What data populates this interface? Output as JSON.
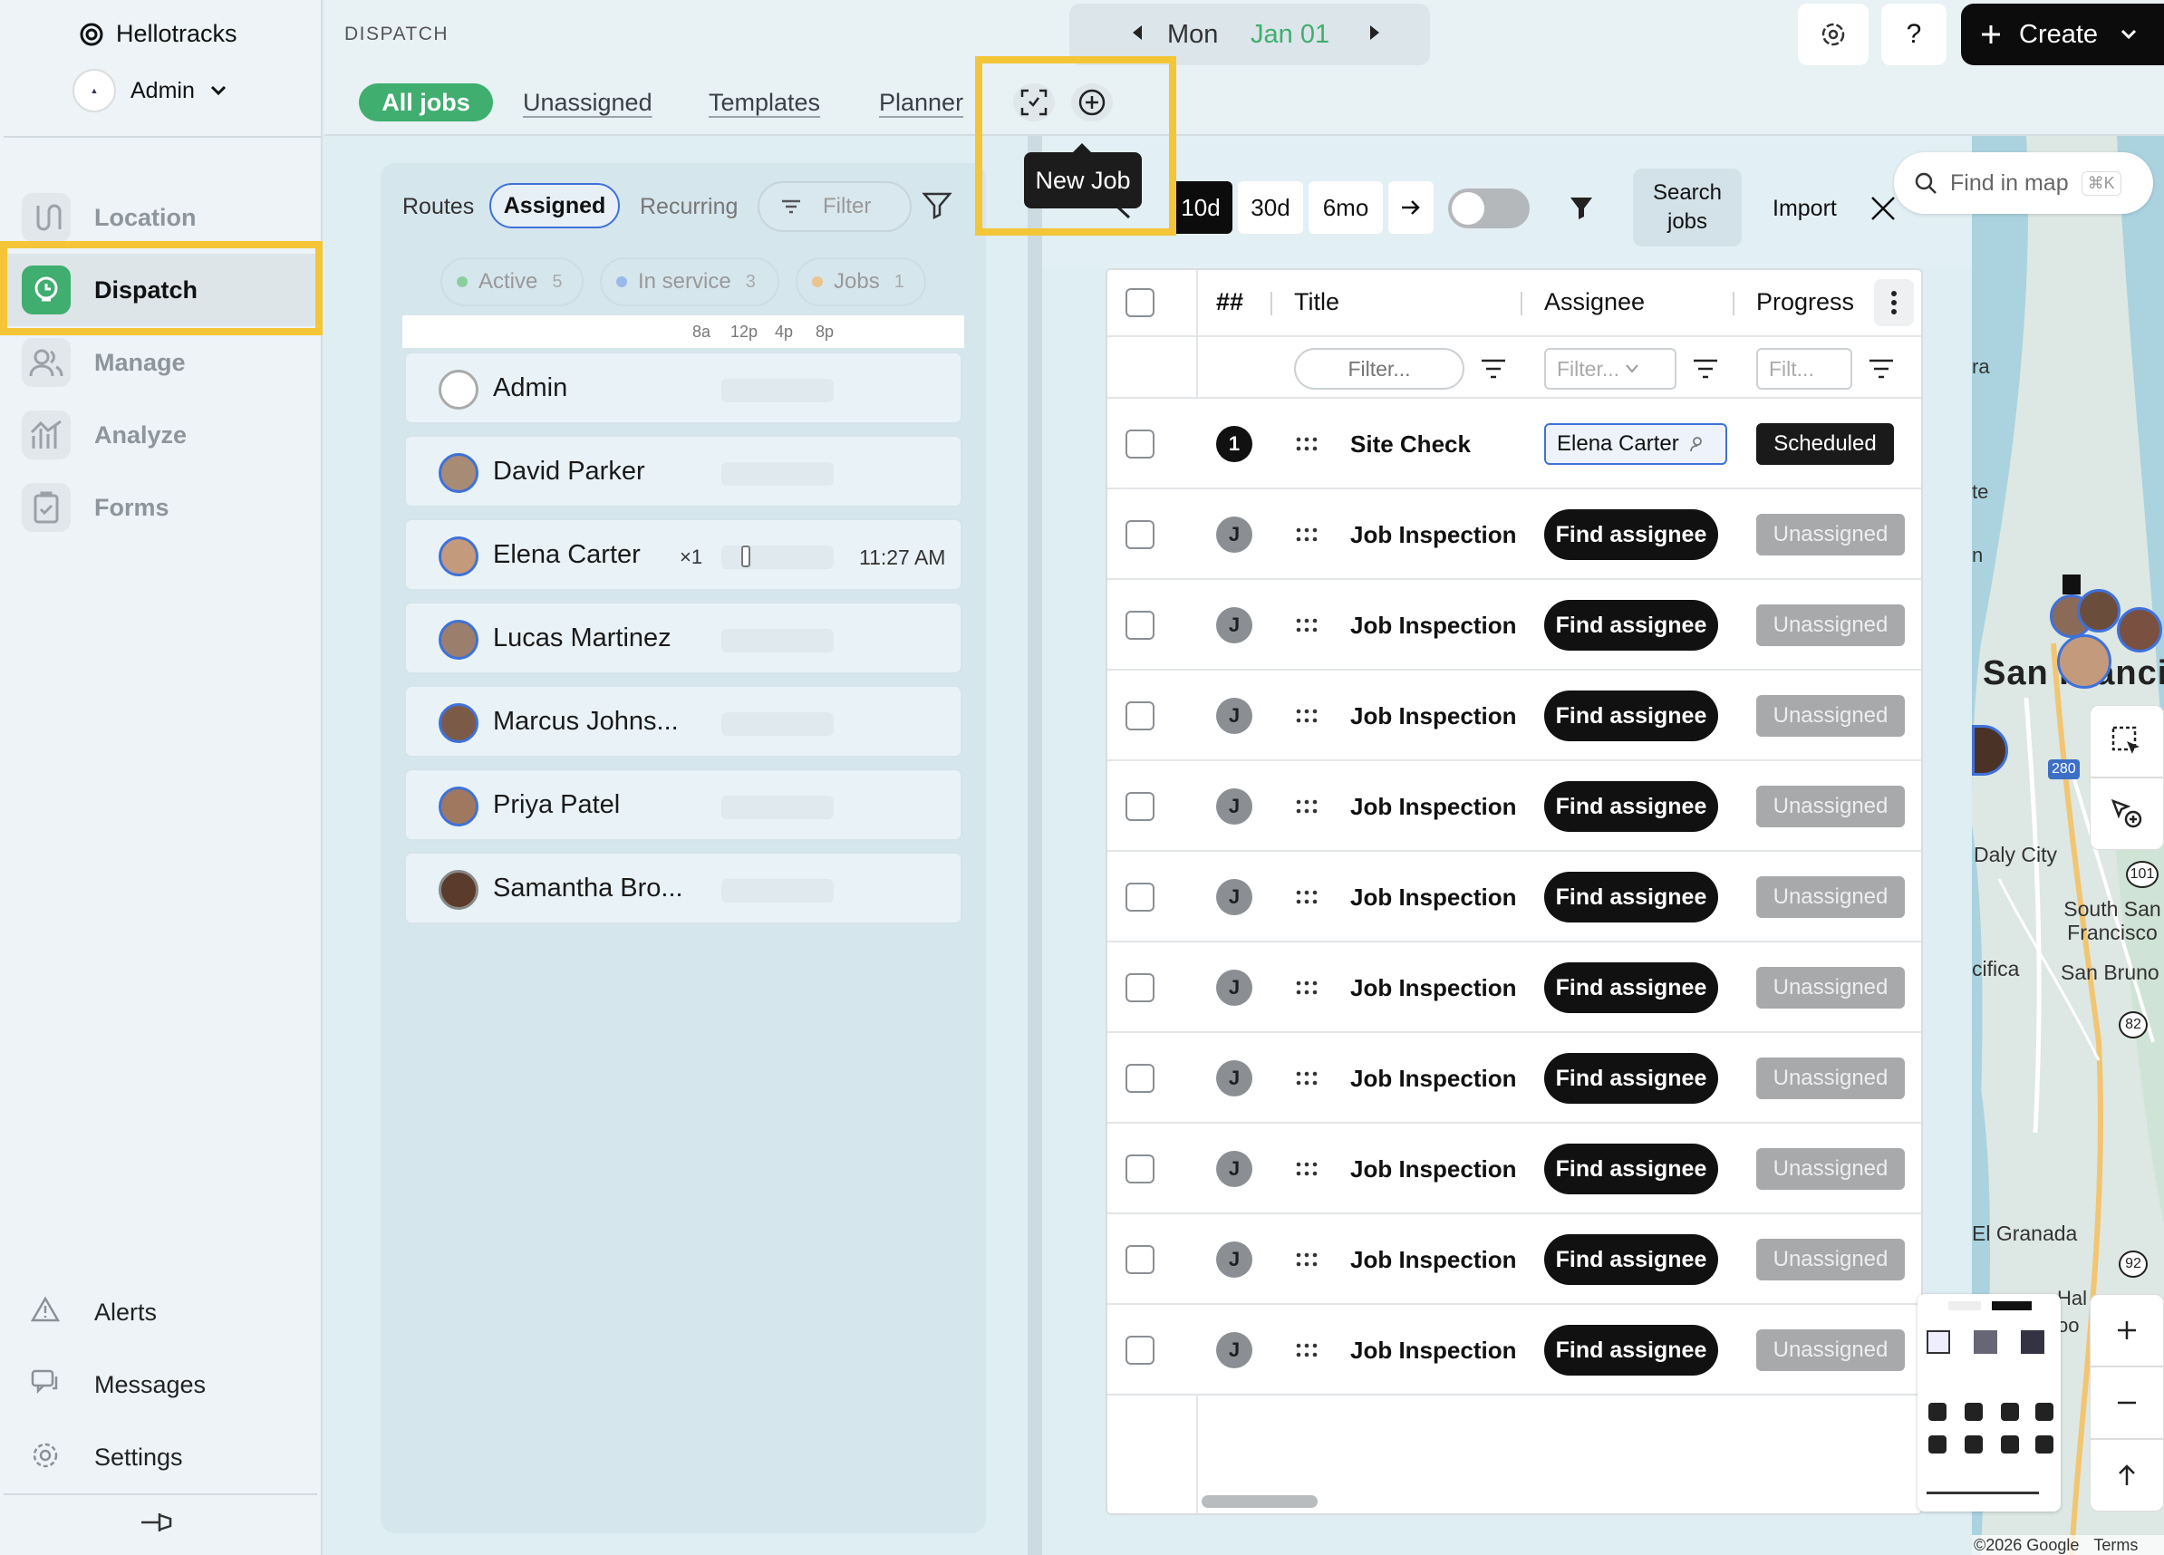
{
  "app": {
    "name": "Hellotracks",
    "org_user": "Admin"
  },
  "sidebar": {
    "items": [
      {
        "label": "Location"
      },
      {
        "label": "Dispatch"
      },
      {
        "label": "Manage"
      },
      {
        "label": "Analyze"
      },
      {
        "label": "Forms"
      }
    ],
    "bottom": [
      {
        "label": "Alerts"
      },
      {
        "label": "Messages"
      },
      {
        "label": "Settings"
      }
    ]
  },
  "header": {
    "section": "DISPATCH",
    "date_day": "Mon",
    "date_value": "Jan 01",
    "tabs": [
      "All jobs",
      "Unassigned",
      "Templates",
      "Planner"
    ],
    "help": "?",
    "create": "Create",
    "tooltip": "New Job"
  },
  "routes": {
    "tabs": [
      "Routes",
      "Assigned",
      "Recurring"
    ],
    "filter_placeholder": "Filter",
    "chips": [
      {
        "label": "Active",
        "count": "5"
      },
      {
        "label": "In service",
        "count": "3"
      },
      {
        "label": "Jobs",
        "count": "1"
      }
    ],
    "time_ticks": [
      "8a",
      "12p",
      "4p",
      "8p"
    ],
    "people": [
      {
        "name": "Admin"
      },
      {
        "name": "David Parker"
      },
      {
        "name": "Elena Carter",
        "count": "×1",
        "time": "11:27 AM"
      },
      {
        "name": "Lucas Martinez"
      },
      {
        "name": "Marcus Johns..."
      },
      {
        "name": "Priya Patel"
      },
      {
        "name": "Samantha Bro..."
      }
    ]
  },
  "jobs_toolbar": {
    "ranges": [
      "10d",
      "30d",
      "6mo"
    ],
    "search": [
      "Search",
      "jobs"
    ],
    "import": "Import"
  },
  "table": {
    "columns": [
      "##",
      "Title",
      "Assignee",
      "Progress"
    ],
    "filter_placeholders": [
      "Filter...",
      "Filter...",
      "Filt..."
    ],
    "rows": [
      {
        "num": "1",
        "title": "Site Check",
        "assignee": "Elena Carter",
        "progress": "Scheduled"
      },
      {
        "num": "J",
        "title": "Job Inspection",
        "assignee": "Find assignee",
        "progress": "Unassigned"
      },
      {
        "num": "J",
        "title": "Job Inspection",
        "assignee": "Find assignee",
        "progress": "Unassigned"
      },
      {
        "num": "J",
        "title": "Job Inspection",
        "assignee": "Find assignee",
        "progress": "Unassigned"
      },
      {
        "num": "J",
        "title": "Job Inspection",
        "assignee": "Find assignee",
        "progress": "Unassigned"
      },
      {
        "num": "J",
        "title": "Job Inspection",
        "assignee": "Find assignee",
        "progress": "Unassigned"
      },
      {
        "num": "J",
        "title": "Job Inspection",
        "assignee": "Find assignee",
        "progress": "Unassigned"
      },
      {
        "num": "J",
        "title": "Job Inspection",
        "assignee": "Find assignee",
        "progress": "Unassigned"
      },
      {
        "num": "J",
        "title": "Job Inspection",
        "assignee": "Find assignee",
        "progress": "Unassigned"
      },
      {
        "num": "J",
        "title": "Job Inspection",
        "assignee": "Find assignee",
        "progress": "Unassigned"
      },
      {
        "num": "J",
        "title": "Job Inspection",
        "assignee": "Find assignee",
        "progress": "Unassigned"
      }
    ]
  },
  "map": {
    "search_placeholder": "Find in map",
    "shortcut": "⌘K",
    "labels": [
      "ra",
      "te",
      "n",
      "San Francisco",
      "Daly City",
      "South San Francisco",
      "San Bruno",
      "cifica",
      "El Granada",
      "Hal",
      "oo"
    ],
    "shields": [
      "280",
      "101",
      "82",
      "92"
    ],
    "attribution": "©2026 Google",
    "terms": "Terms"
  }
}
